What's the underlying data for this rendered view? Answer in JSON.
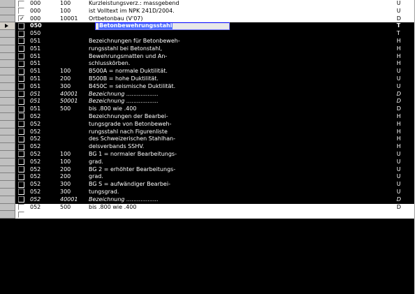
{
  "rows": [
    {
      "kap": "000",
      "pos": "100",
      "text": "Kurzleistungsverz.: massgebend",
      "typ": "U",
      "light": true,
      "checked": false
    },
    {
      "kap": "000",
      "pos": "100",
      "text": "ist Volltext im NPK 241D/2004.",
      "typ": "U",
      "light": true,
      "checked": false
    },
    {
      "kap": "000",
      "pos": "10001",
      "text": "Ortbetonbau (V'07)",
      "typ": "D",
      "light": true,
      "checked": true
    },
    {
      "kap": "050",
      "pos": "",
      "text": "Betonbewehrungsstahl",
      "typ": "T",
      "bold": true,
      "current": true,
      "editing": true
    },
    {
      "kap": "050",
      "pos": "",
      "text": "",
      "typ": "T"
    },
    {
      "kap": "051",
      "pos": "",
      "text": "Bezeichnungen für Betonbeweh-",
      "typ": "H"
    },
    {
      "kap": "051",
      "pos": "",
      "text": "rungsstahl bei Betonstahl,",
      "typ": "H"
    },
    {
      "kap": "051",
      "pos": "",
      "text": "Bewehrungsmatten und An-",
      "typ": "H"
    },
    {
      "kap": "051",
      "pos": "",
      "text": "schlusskörben.",
      "typ": "H"
    },
    {
      "kap": "051",
      "pos": "100",
      "text": "B500A = normale Duktilität.",
      "typ": "U"
    },
    {
      "kap": "051",
      "pos": "200",
      "text": "B500B = hohe Duktilität.",
      "typ": "U"
    },
    {
      "kap": "051",
      "pos": "300",
      "text": "B450C = seismische Duktilität.",
      "typ": "U"
    },
    {
      "kap": "051",
      "pos": "40001",
      "text": "Bezeichnung ..................",
      "typ": "D",
      "italic": true
    },
    {
      "kap": "051",
      "pos": "50001",
      "text": "Bezeichnung ..................",
      "typ": "D",
      "italic": true
    },
    {
      "kap": "051",
      "pos": "500",
      "text": "bis .800 wie .400",
      "typ": "D"
    },
    {
      "kap": "052",
      "pos": "",
      "text": "Bezeichnungen der Bearbei-",
      "typ": "H"
    },
    {
      "kap": "052",
      "pos": "",
      "text": "tungsgrade von Betonbeweh-",
      "typ": "H"
    },
    {
      "kap": "052",
      "pos": "",
      "text": "rungsstahl nach Figurenliste",
      "typ": "H"
    },
    {
      "kap": "052",
      "pos": "",
      "text": "des Schweizerischen Stahlhan-",
      "typ": "H"
    },
    {
      "kap": "052",
      "pos": "",
      "text": "delsverbands SSHV.",
      "typ": "H"
    },
    {
      "kap": "052",
      "pos": "100",
      "text": "BG 1 = normaler Bearbeitungs-",
      "typ": "U"
    },
    {
      "kap": "052",
      "pos": "100",
      "text": "grad.",
      "typ": "U"
    },
    {
      "kap": "052",
      "pos": "200",
      "text": "BG 2 = erhöhter Bearbeitungs-",
      "typ": "U"
    },
    {
      "kap": "052",
      "pos": "200",
      "text": "grad.",
      "typ": "U"
    },
    {
      "kap": "052",
      "pos": "300",
      "text": "BG S = aufwändiger Bearbei-",
      "typ": "U"
    },
    {
      "kap": "052",
      "pos": "300",
      "text": "tungsgrad.",
      "typ": "U"
    },
    {
      "kap": "052",
      "pos": "40001",
      "text": "Bezeichnung ..................",
      "typ": "D",
      "italic": true
    },
    {
      "kap": "052",
      "pos": "500",
      "text": "bis .800 wie .400",
      "typ": "D",
      "light": true
    },
    {
      "kap": "",
      "pos": "",
      "text": "",
      "typ": "",
      "light": true
    }
  ],
  "colors": {
    "grid_bg": "#000000",
    "light_row_bg": "#ffffff",
    "selection": "#5070ff"
  },
  "icons": {
    "row_pointer": "triangle-right-icon",
    "check": "checkmark-icon"
  }
}
